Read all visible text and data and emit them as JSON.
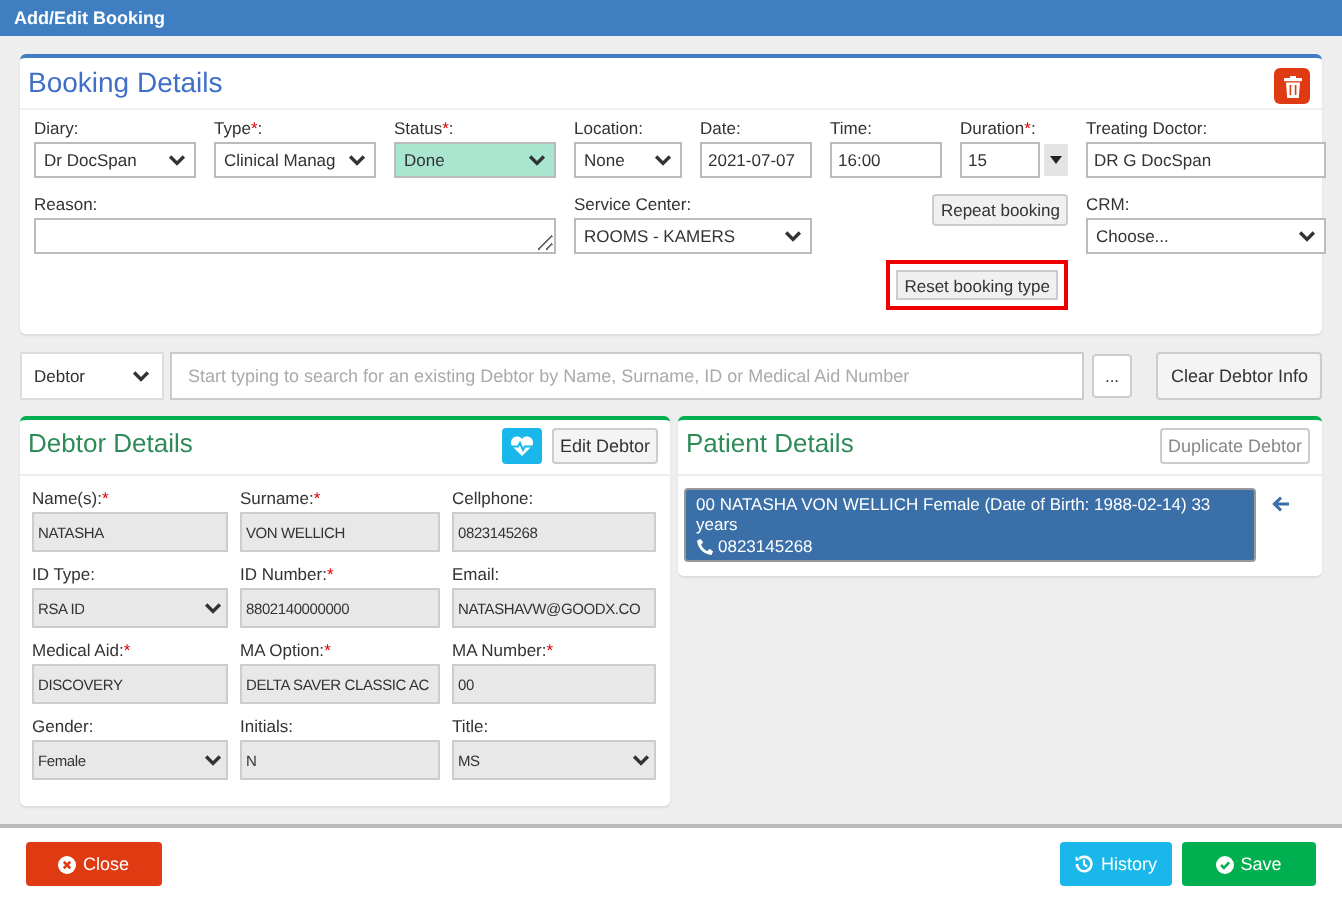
{
  "window": {
    "title": "Add/Edit Booking"
  },
  "booking": {
    "title": "Booking Details",
    "fields": [
      {
        "kind": "select",
        "label": "Diary:",
        "value": "Dr DocSpan"
      },
      {
        "kind": "select",
        "label": "Type",
        "required_mark": "*",
        "label_end": ":",
        "value": "Clinical Manag"
      },
      {
        "kind": "select",
        "label": "Status",
        "required_mark": "*",
        "label_end": ":",
        "value": "Done",
        "color": "#a8e6cf"
      },
      {
        "kind": "select",
        "label": "Location:",
        "value": "None"
      },
      {
        "kind": "input",
        "label": "Date:",
        "value": "2021-07-07"
      },
      {
        "kind": "input",
        "label": "Time:",
        "value": "16:00"
      },
      {
        "kind": "spin",
        "label": "Duration",
        "required_mark": "*",
        "label_end": ":",
        "value": "15"
      },
      {
        "kind": "input",
        "label": "Treating Doctor:",
        "value": "DR G DocSpan"
      }
    ],
    "reason": {
      "label": "Reason:"
    },
    "service_center": {
      "label": "Service Center:",
      "value": "ROOMS - KAMERS"
    },
    "repeat_button": "Repeat booking",
    "crm": {
      "label": "CRM:",
      "value": "Choose..."
    },
    "reset_button": {
      "label": "Reset booking type",
      "highlighted": true
    }
  },
  "debtor_search": {
    "type": "Debtor",
    "placeholder": "Start typing to search for an existing Debtor by Name, Surname, ID or Medical Aid Number",
    "more_button": "...",
    "clear_button": "Clear Debtor Info"
  },
  "debtor": {
    "title": "Debtor Details",
    "edit_button": "Edit Debtor",
    "fields": [
      {
        "kind": "input",
        "label": "Name(s):",
        "required_mark": "*",
        "value": "NATASHA"
      },
      {
        "kind": "input",
        "label": "Surname:",
        "required_mark": "*",
        "value": "VON WELLICH"
      },
      {
        "kind": "input",
        "label": "Cellphone:",
        "value": "0823145268"
      },
      {
        "kind": "select",
        "label": "ID Type:",
        "value": "RSA ID"
      },
      {
        "kind": "input",
        "label": "ID Number:",
        "required_mark": "*",
        "value": "8802140000000"
      },
      {
        "kind": "input",
        "label": "Email:",
        "value": "NATASHAVW@GOODX.CO"
      },
      {
        "kind": "input",
        "label": "Medical Aid:",
        "required_mark": "*",
        "value": "DISCOVERY"
      },
      {
        "kind": "input",
        "label": "MA Option:",
        "required_mark": "*",
        "value": "DELTA SAVER CLASSIC AC"
      },
      {
        "kind": "input",
        "label": "MA Number:",
        "required_mark": "*",
        "value": "00"
      },
      {
        "kind": "select",
        "label": "Gender:",
        "value": "Female"
      },
      {
        "kind": "input",
        "label": "Initials:",
        "value": "N"
      },
      {
        "kind": "select",
        "label": "Title:",
        "value": "MS"
      }
    ]
  },
  "patient": {
    "title": "Patient Details",
    "duplicate_button": "Duplicate Debtor",
    "items": [
      {
        "text": "00 NATASHA VON WELLICH Female (Date of Birth: 1988-02-14) 33 years",
        "phone": "0823145268",
        "selected": true
      }
    ]
  },
  "footer": {
    "close_button": "Close",
    "history_button": "History",
    "save_button": "Save"
  }
}
